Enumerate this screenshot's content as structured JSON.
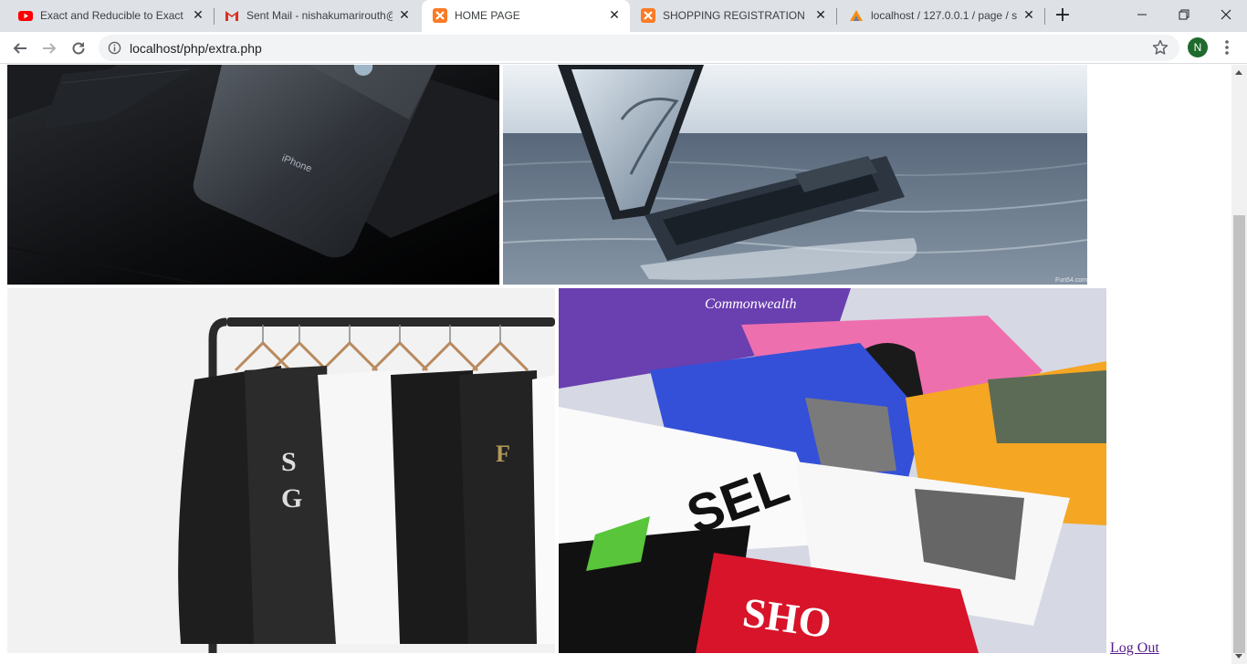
{
  "browser": {
    "tabs": [
      {
        "title": "Exact and Reducible to Exact d",
        "favicon": "youtube-icon",
        "active": false
      },
      {
        "title": "Sent Mail - nishakumarirouth@",
        "favicon": "gmail-icon",
        "active": false
      },
      {
        "title": "HOME PAGE",
        "favicon": "xampp-icon",
        "active": true
      },
      {
        "title": "SHOPPING REGISTRATION",
        "favicon": "xampp-icon",
        "active": false
      },
      {
        "title": "localhost / 127.0.0.1 / page / s",
        "favicon": "phpmyadmin-icon",
        "active": false
      }
    ],
    "new_tab_label": "+",
    "url": "localhost/php/extra.php",
    "profile_initial": "N",
    "colors": {
      "tabstrip": "#dee1e6",
      "profile": "#1e6b2c",
      "omnibox": "#f1f3f4"
    }
  },
  "page": {
    "images": [
      {
        "alt": "iphone-photo"
      },
      {
        "alt": "laptop-in-water-photo"
      },
      {
        "alt": "tshirts-on-rack-photo"
      },
      {
        "alt": "folded-tshirts-photo"
      }
    ],
    "logout_label": "Log Out",
    "link_color": "#551a8b"
  }
}
